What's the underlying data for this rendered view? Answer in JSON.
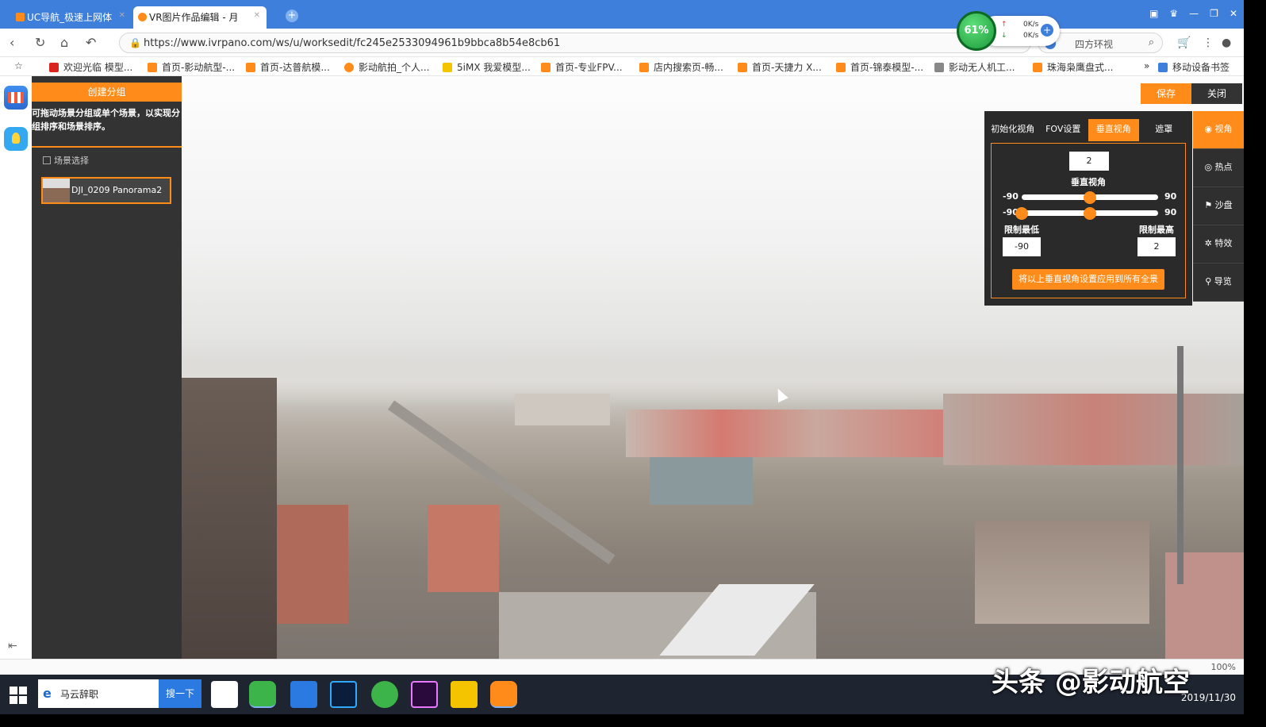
{
  "browser": {
    "tabs": [
      {
        "label": "UC导航_极速上网体",
        "favicon_color": "#ff8c1a"
      },
      {
        "label": "VR图片作品编辑 - 月",
        "favicon_color": "#ff8c1a"
      }
    ],
    "url": "https://www.ivrpano.com/ws/u/worksedit/fc245e2533094961b9bbca8b54e8cb61",
    "search_engine_text": "四方环视",
    "net_widget": {
      "percent": "61%",
      "up": "0K/s",
      "down": "0K/s"
    },
    "bookmarks": [
      {
        "label": "欢迎光临 模型...",
        "color": "#d9251d"
      },
      {
        "label": "首页-影动航型-...",
        "color": "#ff8c1a"
      },
      {
        "label": "首页-达普航模...",
        "color": "#ff8c1a"
      },
      {
        "label": "影动航拍_个人...",
        "color": "#ff8c1a"
      },
      {
        "label": "5iMX 我爱模型...",
        "color": "#f5c400"
      },
      {
        "label": "首页-专业FPV...",
        "color": "#ff8c1a"
      },
      {
        "label": "店内搜索页-畅...",
        "color": "#ff8c1a"
      },
      {
        "label": "首页-天捷力 X...",
        "color": "#ff8c1a"
      },
      {
        "label": "首页-锦泰模型-...",
        "color": "#ff8c1a"
      },
      {
        "label": "影动无人机工...",
        "color": "#888888"
      },
      {
        "label": "珠海枭鹰盘式...",
        "color": "#ff8c1a"
      }
    ],
    "bookmarks_more": "»",
    "mobile_bookmarks": "移动设备书签"
  },
  "sidebar": {
    "create_group": "创建分组",
    "hint": "可拖动场景分组或单个场景，以实现分组排序和场景排序。",
    "scene_select": "场景选择",
    "scenes": [
      {
        "name": "DJI_0209 Panorama2"
      }
    ]
  },
  "actions": {
    "save": "保存",
    "close": "关闭"
  },
  "view_panel": {
    "tabs": [
      "初始化视角",
      "FOV设置",
      "垂直视角",
      "遮罩"
    ],
    "active_tab": "垂直视角",
    "value": "2",
    "title": "垂直视角",
    "slider1": {
      "min": "-90",
      "max": "90",
      "position": 0.5
    },
    "slider2": {
      "min": "-90",
      "max": "90",
      "low_position": 0.0,
      "high_position": 0.5
    },
    "limit_low_label": "限制最低",
    "limit_high_label": "限制最高",
    "limit_low": "-90",
    "limit_high": "2",
    "apply": "将以上垂直视角设置应用到所有全景"
  },
  "right_nav": [
    "视角",
    "热点",
    "沙盘",
    "特效",
    "导览"
  ],
  "status": {
    "zoom": "100%"
  },
  "taskbar": {
    "search_text": "马云辞职",
    "search_button": "搜一下",
    "date": "2019/11/30",
    "watermark": "头条 @影动航空"
  },
  "colors": {
    "accent": "#ff8c1a",
    "panel": "#2a2a2a",
    "sidebar": "#333333",
    "browser_blue": "#3f7fdc"
  }
}
